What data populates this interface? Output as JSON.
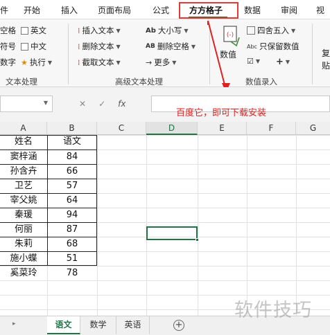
{
  "menu": {
    "items": [
      "件",
      "开始",
      "插入",
      "页面布局",
      "公式",
      "方方格子",
      "数据",
      "审阅",
      "视"
    ],
    "active": "方方格子"
  },
  "ribbon": {
    "text_group": {
      "col1": [
        "空格",
        "符号",
        "数字"
      ],
      "english": "英文",
      "chinese": "中文",
      "execute": "执行",
      "label": "文本处理"
    },
    "advanced_group": {
      "insert_text": "插入文本",
      "delete_text": "删除文本",
      "extract_text": "截取文本",
      "case": "大小写",
      "delete_spaces": "删除空格",
      "more": "更多",
      "label": "高级文本处理"
    },
    "number_group": {
      "value_label": "数值",
      "round": "四舍五入",
      "keep_value": "只保留数值",
      "label": "数值录入"
    },
    "right_cut": [
      "复",
      "贴"
    ]
  },
  "formula_bar": {
    "fx": "fx",
    "cancel": "✕",
    "confirm": "✓"
  },
  "annotation": "百度它，即可下载安装",
  "grid": {
    "columns": [
      "A",
      "B",
      "C",
      "D",
      "E",
      "F",
      "G"
    ],
    "active_column": "D",
    "header": [
      "姓名",
      "语文"
    ],
    "rows": [
      [
        "窦梓涵",
        "84"
      ],
      [
        "孙含卉",
        "66"
      ],
      [
        "卫艺",
        "57"
      ],
      [
        "宰父姚",
        "64"
      ],
      [
        "秦瑗",
        "94"
      ],
      [
        "何丽",
        "87"
      ],
      [
        "朱莉",
        "68"
      ],
      [
        "施小蝶",
        "51"
      ],
      [
        "奚菜玲",
        "78"
      ]
    ]
  },
  "sheets": {
    "tabs": [
      "语文",
      "数学",
      "英语"
    ],
    "active": "语文",
    "add": "+"
  },
  "watermark": "软件技巧",
  "colors": {
    "accent": "#217346",
    "highlight_box": "#e53935",
    "annotation": "#e02020"
  }
}
